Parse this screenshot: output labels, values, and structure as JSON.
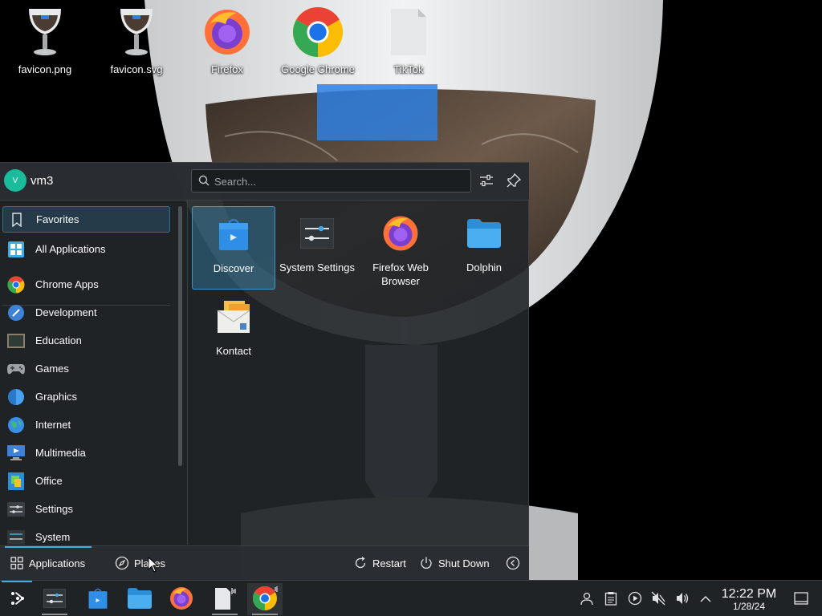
{
  "desktop": {
    "icons": [
      {
        "label": "favicon.png",
        "icon": "goblet-image-icon"
      },
      {
        "label": "favicon.svg",
        "icon": "goblet-image-icon"
      },
      {
        "label": "Firefox",
        "icon": "firefox-icon"
      },
      {
        "label": "Google Chrome",
        "icon": "chrome-icon"
      },
      {
        "label": "TikTok",
        "icon": "blank-file-icon"
      }
    ]
  },
  "menu": {
    "user": {
      "name": "vm3",
      "avatar_letter": "V"
    },
    "search": {
      "placeholder": "Search..."
    },
    "categories": [
      {
        "label": "Favorites",
        "icon": "bookmark-icon",
        "active": true
      },
      {
        "label": "All Applications",
        "icon": "grid-icon"
      },
      {
        "label": "Chrome Apps",
        "icon": "chrome-icon"
      },
      {
        "label": "Development",
        "icon": "development-icon"
      },
      {
        "label": "Education",
        "icon": "education-icon"
      },
      {
        "label": "Games",
        "icon": "gamepad-icon"
      },
      {
        "label": "Graphics",
        "icon": "graphics-icon"
      },
      {
        "label": "Internet",
        "icon": "globe-icon"
      },
      {
        "label": "Multimedia",
        "icon": "multimedia-icon"
      },
      {
        "label": "Office",
        "icon": "office-icon"
      },
      {
        "label": "Settings",
        "icon": "settings-icon"
      },
      {
        "label": "System",
        "icon": "system-icon"
      }
    ],
    "apps": [
      {
        "label": "Discover",
        "icon": "discover-icon",
        "selected": true
      },
      {
        "label": "System Settings",
        "icon": "system-settings-icon"
      },
      {
        "label": "Firefox Web Browser",
        "icon": "firefox-icon"
      },
      {
        "label": "Dolphin",
        "icon": "folder-icon"
      },
      {
        "label": "Kontact",
        "icon": "kontact-icon"
      }
    ],
    "footer": {
      "applications": "Applications",
      "places": "Places",
      "restart": "Restart",
      "shutdown": "Shut Down"
    }
  },
  "taskbar": {
    "clock": {
      "time": "12:22 PM",
      "date": "1/28/24"
    }
  },
  "colors": {
    "accent": "#3daee9",
    "panel": "#232629",
    "taskbar": "#202326"
  }
}
